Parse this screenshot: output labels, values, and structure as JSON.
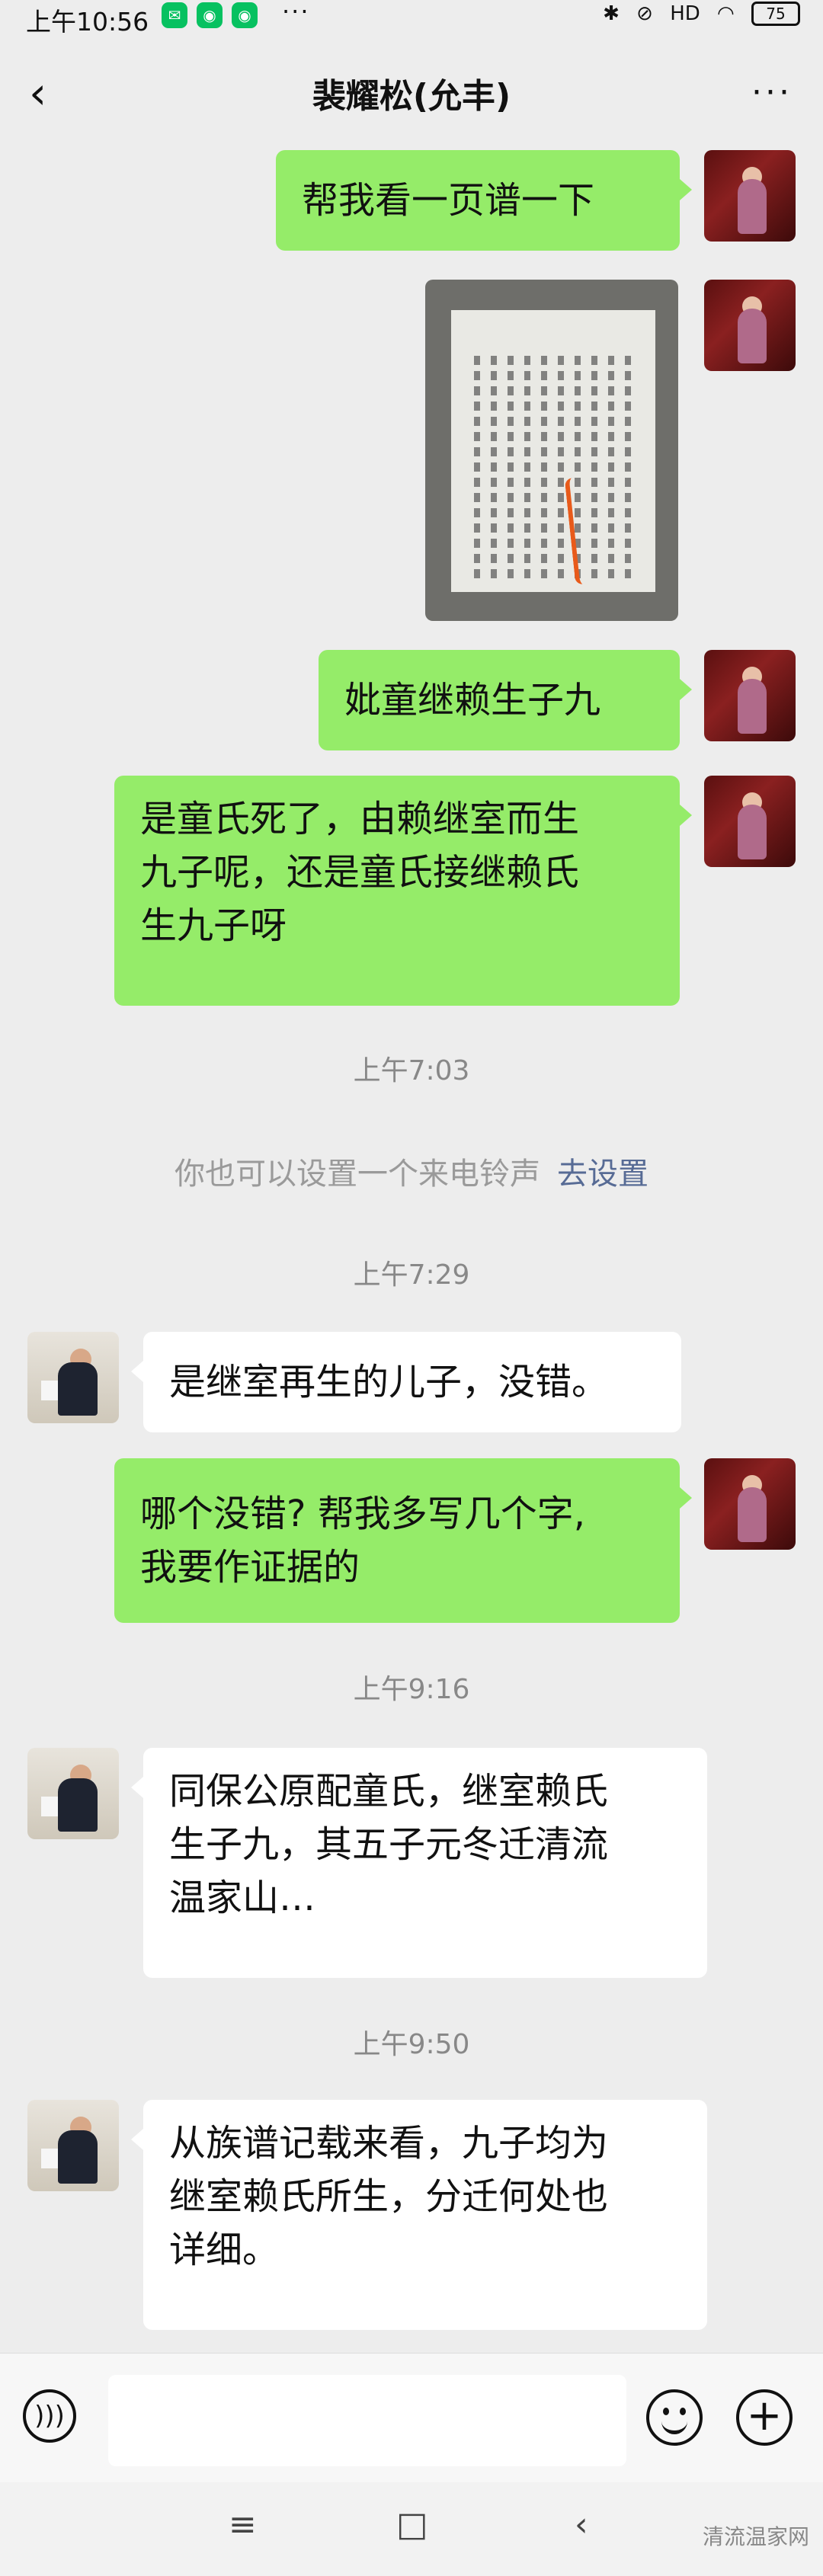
{
  "status_bar": {
    "time": "上午10:56",
    "right_icons": [
      "bluetooth-icon",
      "mute-icon",
      "hd-icon",
      "wifi-icon"
    ],
    "battery": "75"
  },
  "header": {
    "title": "裴耀松(允丰)"
  },
  "messages": [
    {
      "type": "text",
      "from": "me",
      "text": "帮我看一页谱一下"
    },
    {
      "type": "image",
      "from": "me"
    },
    {
      "type": "text",
      "from": "me",
      "text": "妣童继赖生子九"
    },
    {
      "type": "text",
      "from": "me",
      "lines": [
        "是童氏死了，由赖继室而生",
        "九子呢，还是童氏接继赖氏",
        "生九子呀"
      ]
    },
    {
      "type": "time",
      "text": "上午7:03"
    },
    {
      "type": "system",
      "text": "你也可以设置一个来电铃声",
      "link": "去设置"
    },
    {
      "type": "time",
      "text": "上午7:29"
    },
    {
      "type": "text",
      "from": "other",
      "text": "是继室再生的儿子，没错。"
    },
    {
      "type": "text",
      "from": "me",
      "lines": [
        "哪个没错? 帮我多写几个字,",
        "我要作证据的"
      ]
    },
    {
      "type": "time",
      "text": "上午9:16"
    },
    {
      "type": "text",
      "from": "other",
      "lines": [
        "同保公原配童氏，继室赖氏",
        "生子九，其五子元冬迁清流",
        "温家山…"
      ]
    },
    {
      "type": "time",
      "text": "上午9:50"
    },
    {
      "type": "text",
      "from": "other",
      "lines": [
        "从族谱记载来看，九子均为",
        "继室赖氏所生，分迁何处也",
        "详细。"
      ]
    }
  ],
  "watermark": "清流温家网",
  "colors": {
    "me_bubble": "#95ec69",
    "other_bubble": "#ffffff",
    "background": "#ededed",
    "link": "#576b95"
  }
}
